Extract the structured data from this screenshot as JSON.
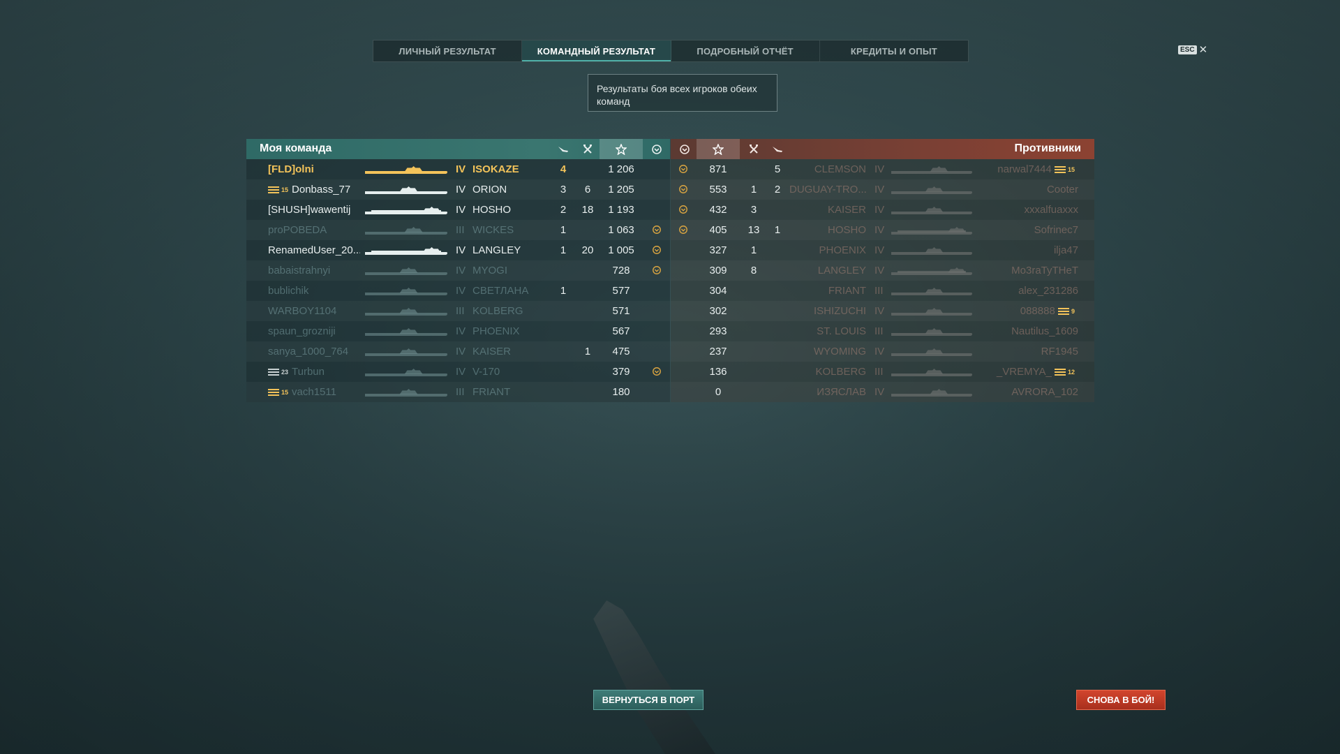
{
  "tabs": [
    {
      "label": "ЛИЧНЫЙ РЕЗУЛЬТАТ",
      "active": false
    },
    {
      "label": "КОМАНДНЫЙ РЕЗУЛЬТАТ",
      "active": true
    },
    {
      "label": "ПОДРОБНЫЙ ОТЧЁТ",
      "active": false
    },
    {
      "label": "КРЕДИТЫ И ОПЫТ",
      "active": false
    }
  ],
  "esc_label": "ESC",
  "close_glyph": "✕",
  "tooltip": "Результаты боя всех игроков обеих команд",
  "my_team": {
    "title": "Моя команда",
    "columns_icons": [
      "plane-kills-icon",
      "ship-kills-icon",
      "base-xp-star-icon",
      "achievements-icon"
    ],
    "rows": [
      {
        "rank": "",
        "player": "[FLD]olni",
        "tier": "IV",
        "ship": "ISOKAZE",
        "planes": "4",
        "kills": "",
        "xp": "1 206",
        "medal": false,
        "style": "gold",
        "silhouette": "destroyer"
      },
      {
        "rank": "15",
        "rank_style": "gold",
        "player": "Donbass_77",
        "tier": "IV",
        "ship": "ORION",
        "planes": "3",
        "kills": "6",
        "xp": "1 205",
        "medal": false,
        "style": "bright",
        "silhouette": "battleship"
      },
      {
        "rank": "",
        "player": "[SHUSH]wawentij",
        "tier": "IV",
        "ship": "HOSHO",
        "planes": "2",
        "kills": "18",
        "xp": "1 193",
        "medal": false,
        "style": "bright",
        "silhouette": "carrier"
      },
      {
        "rank": "",
        "player": "proPOBEDA",
        "tier": "III",
        "ship": "WICKES",
        "planes": "1",
        "kills": "",
        "xp": "1 063",
        "medal": true,
        "style": "dim",
        "silhouette": "destroyer"
      },
      {
        "rank": "",
        "player": "RenamedUser_20...",
        "tier": "IV",
        "ship": "LANGLEY",
        "planes": "1",
        "kills": "20",
        "xp": "1 005",
        "medal": true,
        "style": "bright",
        "silhouette": "carrier"
      },
      {
        "rank": "",
        "player": "babaistrahnyi",
        "tier": "IV",
        "ship": "MYOGI",
        "planes": "",
        "kills": "",
        "xp": "728",
        "medal": true,
        "style": "dim",
        "silhouette": "battleship"
      },
      {
        "rank": "",
        "player": "bublichik",
        "tier": "IV",
        "ship": "СВЕТЛАНА",
        "planes": "1",
        "kills": "",
        "xp": "577",
        "medal": false,
        "style": "dim",
        "silhouette": "cruiser"
      },
      {
        "rank": "",
        "player": "WARBOY1104",
        "tier": "III",
        "ship": "KOLBERG",
        "planes": "",
        "kills": "",
        "xp": "571",
        "medal": false,
        "style": "dim",
        "silhouette": "cruiser"
      },
      {
        "rank": "",
        "player": "spaun_grozniji",
        "tier": "IV",
        "ship": "PHOENIX",
        "planes": "",
        "kills": "",
        "xp": "567",
        "medal": false,
        "style": "dim",
        "silhouette": "cruiser"
      },
      {
        "rank": "",
        "player": "sanya_1000_764",
        "tier": "IV",
        "ship": "KAISER",
        "planes": "",
        "kills": "1",
        "xp": "475",
        "medal": false,
        "style": "dim",
        "silhouette": "battleship"
      },
      {
        "rank": "23",
        "rank_style": "gray",
        "player": "Turbun",
        "tier": "IV",
        "ship": "V-170",
        "planes": "",
        "kills": "",
        "xp": "379",
        "medal": true,
        "style": "dim",
        "silhouette": "destroyer"
      },
      {
        "rank": "15",
        "rank_style": "gold",
        "player": "vach1511",
        "tier": "III",
        "ship": "FRIANT",
        "planes": "",
        "kills": "",
        "xp": "180",
        "medal": false,
        "style": "dim",
        "silhouette": "cruiser"
      }
    ]
  },
  "enemy_team": {
    "title": "Противники",
    "columns_icons": [
      "achievements-icon",
      "base-xp-star-icon",
      "ship-kills-icon",
      "plane-kills-icon"
    ],
    "rows": [
      {
        "medal": true,
        "xp": "871",
        "kills": "",
        "planes": "5",
        "ship": "CLEMSON",
        "tier": "IV",
        "player": "narwal7444",
        "rank": "15",
        "rank_style": "gold",
        "silhouette": "destroyer"
      },
      {
        "medal": true,
        "xp": "553",
        "kills": "1",
        "planes": "2",
        "ship": "DUGUAY-TRO...",
        "tier": "IV",
        "player": "Cooter",
        "rank": "",
        "silhouette": "cruiser"
      },
      {
        "medal": true,
        "xp": "432",
        "kills": "3",
        "planes": "",
        "ship": "KAISER",
        "tier": "IV",
        "player": "xxxalfuaxxx",
        "rank": "",
        "silhouette": "battleship"
      },
      {
        "medal": true,
        "xp": "405",
        "kills": "13",
        "planes": "1",
        "ship": "HOSHO",
        "tier": "IV",
        "player": "Sofrinec7",
        "rank": "",
        "silhouette": "carrier"
      },
      {
        "medal": false,
        "xp": "327",
        "kills": "1",
        "planes": "",
        "ship": "PHOENIX",
        "tier": "IV",
        "player": "ilja47",
        "rank": "",
        "silhouette": "cruiser"
      },
      {
        "medal": false,
        "xp": "309",
        "kills": "8",
        "planes": "",
        "ship": "LANGLEY",
        "tier": "IV",
        "player": "Mo3raTyTHeT",
        "rank": "",
        "silhouette": "carrier"
      },
      {
        "medal": false,
        "xp": "304",
        "kills": "",
        "planes": "",
        "ship": "FRIANT",
        "tier": "III",
        "player": "alex_231286",
        "rank": "",
        "silhouette": "cruiser"
      },
      {
        "medal": false,
        "xp": "302",
        "kills": "",
        "planes": "",
        "ship": "ISHIZUCHI",
        "tier": "IV",
        "player": "088888",
        "rank": "9",
        "rank_style": "gold",
        "silhouette": "battleship"
      },
      {
        "medal": false,
        "xp": "293",
        "kills": "",
        "planes": "",
        "ship": "ST. LOUIS",
        "tier": "III",
        "player": "Nautilus_1609",
        "rank": "",
        "silhouette": "cruiser"
      },
      {
        "medal": false,
        "xp": "237",
        "kills": "",
        "planes": "",
        "ship": "WYOMING",
        "tier": "IV",
        "player": "RF1945",
        "rank": "",
        "silhouette": "battleship"
      },
      {
        "medal": false,
        "xp": "136",
        "kills": "",
        "planes": "",
        "ship": "KOLBERG",
        "tier": "III",
        "player": "_VREMYA_",
        "rank": "12",
        "rank_style": "gold",
        "silhouette": "cruiser"
      },
      {
        "medal": false,
        "xp": "0",
        "kills": "",
        "planes": "",
        "ship": "ИЗЯСЛАВ",
        "tier": "IV",
        "player": "AVRORA_102",
        "rank": "",
        "silhouette": "destroyer"
      }
    ]
  },
  "buttons": {
    "port": "ВЕРНУТЬСЯ В ПОРТ",
    "battle": "СНОВА В БОЙ!"
  },
  "colors": {
    "my_team_header": "#3a7670",
    "enemy_header": "#7a4034",
    "highlight_player": "#f3c35a",
    "battle_button": "#c23c25"
  }
}
